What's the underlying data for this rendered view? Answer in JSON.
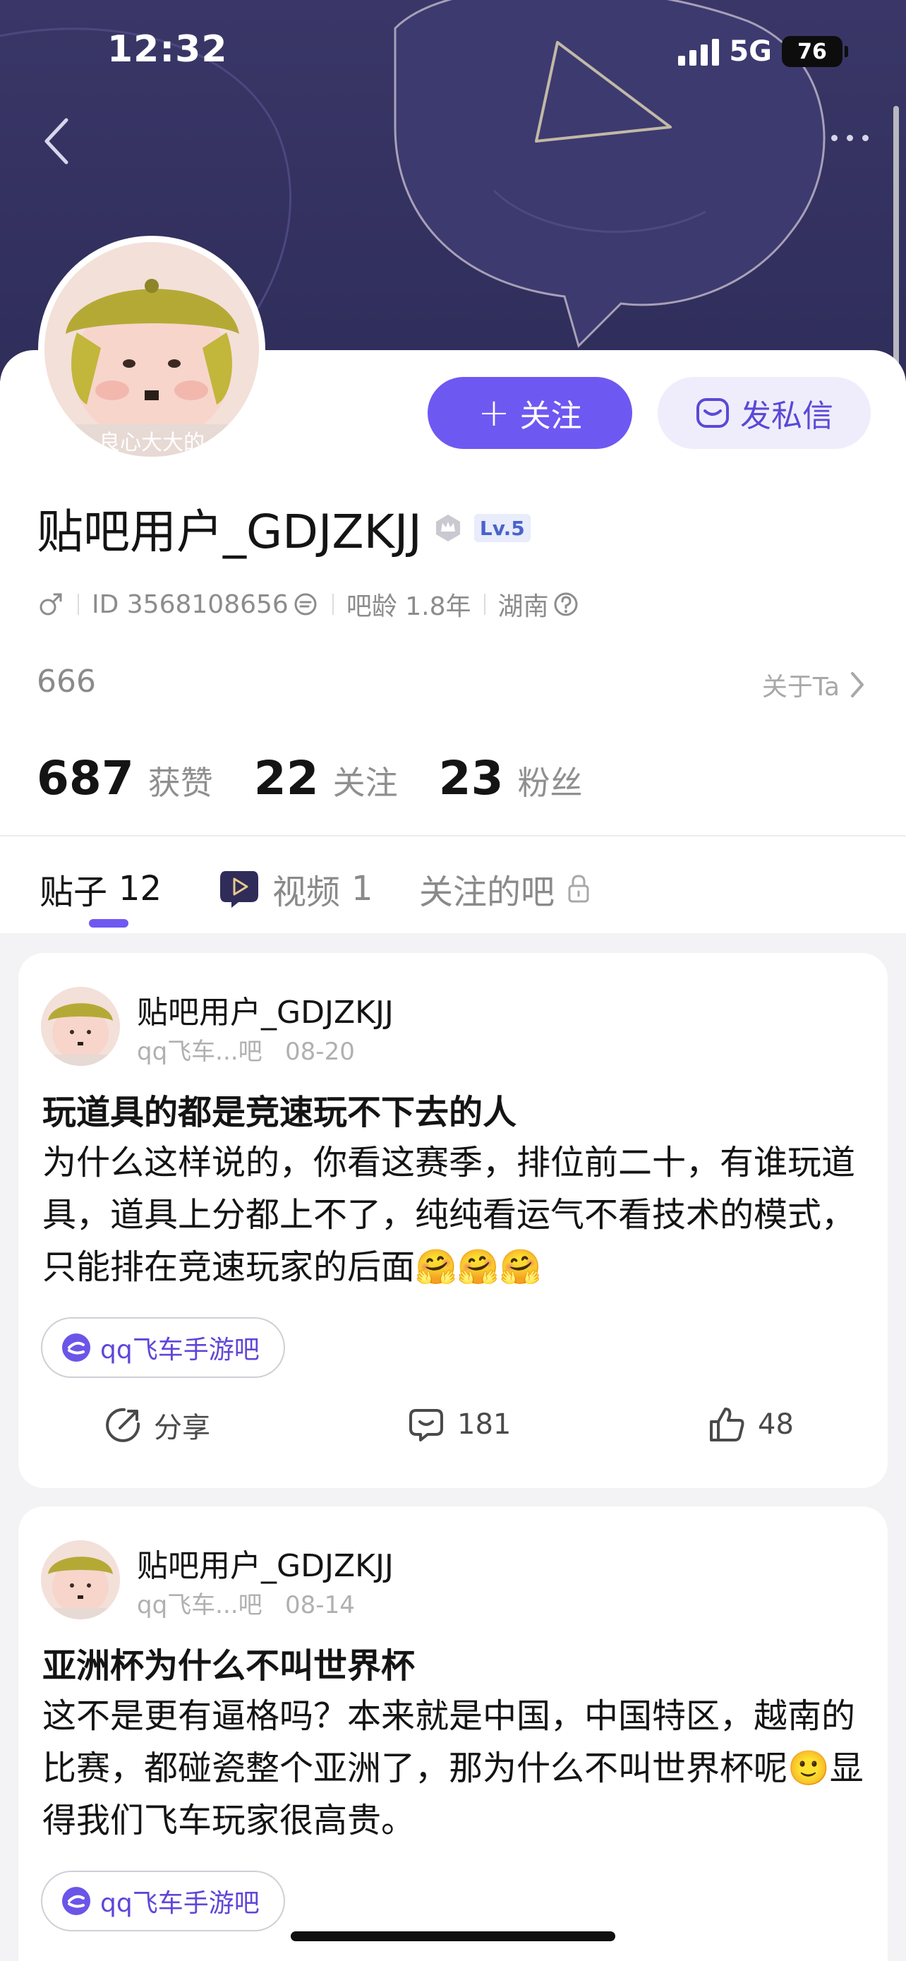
{
  "status_bar": {
    "time": "12:32",
    "network": "5G",
    "battery": "76"
  },
  "profile": {
    "username": "贴吧用户_GDJZKJJ",
    "level": "Lv.5",
    "gender_icon": "male-icon",
    "id_text": "ID 3568108656",
    "tieba_age": "吧龄 1.8年",
    "location": "湖南",
    "bio": "666",
    "about_label": "关于Ta",
    "follow_label": "关注",
    "message_label": "发私信",
    "avatar_caption": "良心大大的"
  },
  "stats": [
    {
      "value": "687",
      "label": "获赞"
    },
    {
      "value": "22",
      "label": "关注"
    },
    {
      "value": "23",
      "label": "粉丝"
    }
  ],
  "tabs": [
    {
      "label": "贴子",
      "count": "12",
      "active": true
    },
    {
      "label": "视频",
      "count": "1",
      "active": false
    },
    {
      "label": "关注的吧",
      "count": "",
      "active": false
    }
  ],
  "posts": [
    {
      "author": "贴吧用户_GDJZKJJ",
      "forum_short": "qq飞车...吧",
      "date": "08-20",
      "title": "玩道具的都是竞速玩不下去的人",
      "body": "为什么这样说的，你看这赛季，排位前二十，有谁玩道具，道具上分都上不了，纯纯看运气不看技术的模式，只能排在竞速玩家的后面",
      "body_emoji": "🤗🤗🤗",
      "forum_tag": "qq飞车手游吧",
      "share_label": "分享",
      "comments": "181",
      "likes": "48"
    },
    {
      "author": "贴吧用户_GDJZKJJ",
      "forum_short": "qq飞车...吧",
      "date": "08-14",
      "title": "亚洲杯为什么不叫世界杯",
      "body": "这不是更有逼格吗？本来就是中国，中国特区，越南的比赛，都碰瓷整个亚洲了，那为什么不叫世界杯呢",
      "body_emoji": "🙂",
      "body_tail": "显得我们飞车玩家很高贵。",
      "forum_tag": "qq飞车手游吧"
    }
  ],
  "colors": {
    "accent": "#6e58f2",
    "banner": "#34315f",
    "tag_text": "#6046d8"
  }
}
